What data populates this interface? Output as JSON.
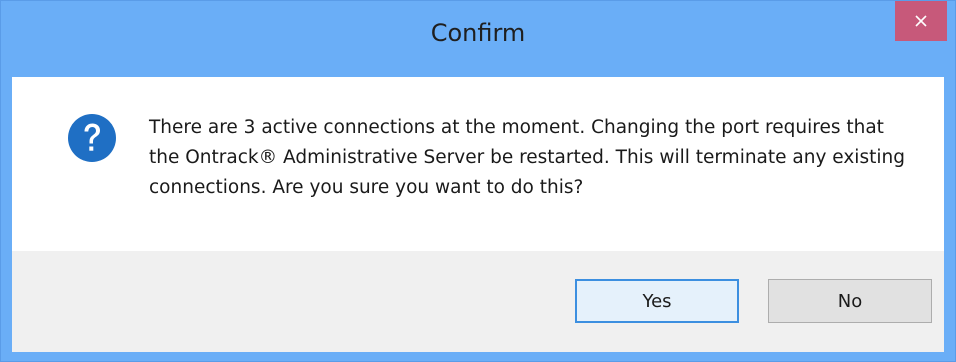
{
  "dialog": {
    "title": "Confirm",
    "close_icon": "close-icon",
    "message": "There are 3 active connections at the moment. Changing the port requires that the Ontrack® Administrative Server be restarted. This will terminate any existing connections. Are you sure you want to do this?",
    "icon": "question-icon",
    "buttons": {
      "yes_label": "Yes",
      "no_label": "No"
    }
  },
  "colors": {
    "title_bar": "#6aaef7",
    "close_button": "#c7597a",
    "question_icon": "#1f6fc4",
    "default_button_border": "#3c8fe0"
  }
}
